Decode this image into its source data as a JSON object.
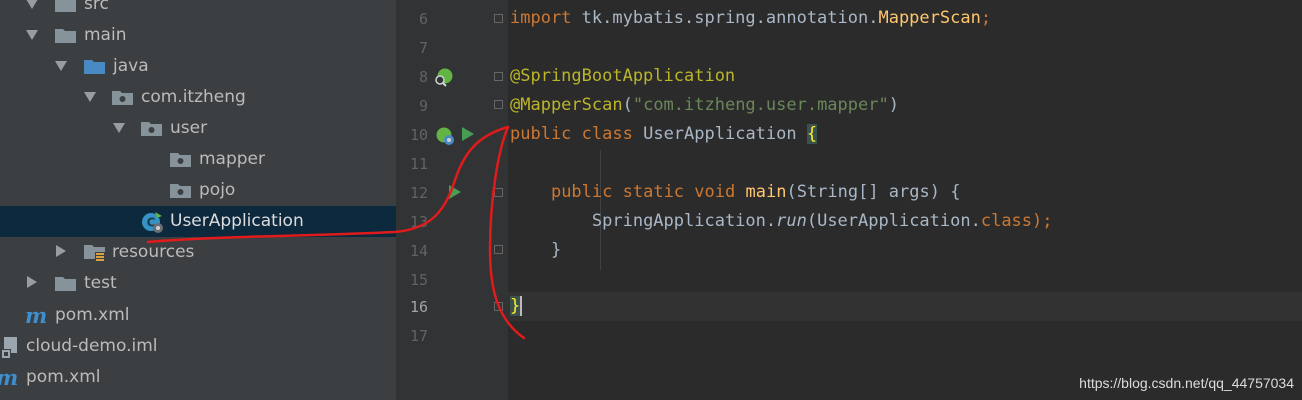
{
  "project_tree": {
    "nodes": [
      {
        "label": "src"
      },
      {
        "label": "main"
      },
      {
        "label": "java"
      },
      {
        "label": "com.itzheng"
      },
      {
        "label": "user"
      },
      {
        "label": "mapper"
      },
      {
        "label": "pojo"
      },
      {
        "label": "UserApplication"
      },
      {
        "label": "resources"
      },
      {
        "label": "test"
      },
      {
        "label": "pom.xml"
      },
      {
        "label": "cloud-demo.iml"
      },
      {
        "label": "pom.xml"
      }
    ],
    "maven_glyph": "m"
  },
  "editor": {
    "line_numbers": [
      "6",
      "7",
      "8",
      "9",
      "10",
      "11",
      "12",
      "13",
      "14",
      "15",
      "16",
      "17"
    ],
    "current_line": "16",
    "code": {
      "l6": {
        "kw": "import",
        "text": " tk.mybatis.spring.annotation.",
        "cls": "MapperScan",
        "end": ";"
      },
      "l8": {
        "ann": "@SpringBootApplication"
      },
      "l9": {
        "ann": "@MapperScan",
        "open": "(",
        "str": "\"com.itzheng.user.mapper\"",
        "close": ")"
      },
      "l10": {
        "kw1": "public",
        "kw2": "class",
        "name": " UserApplication ",
        "brace": "{"
      },
      "l12": {
        "kw1": "public",
        "kw2": "static",
        "kw3": "void",
        "method": "main",
        "params": "(String[] args) ",
        "brace": "{"
      },
      "l13": {
        "cls": "SpringApplication.",
        "call": "run",
        "open": "(UserApplication.",
        "kw": "class",
        "end": ");"
      },
      "l14": {
        "brace": "}"
      },
      "l16": {
        "brace": "}"
      }
    }
  },
  "watermark": "https://blog.csdn.net/qq_44757034",
  "colors": {
    "keyword": "#cc7832",
    "annotation": "#bbb529",
    "string": "#6a8759",
    "method": "#ffc66d",
    "selection": "#0d293e",
    "annotation_stroke": "#e01b1b"
  }
}
